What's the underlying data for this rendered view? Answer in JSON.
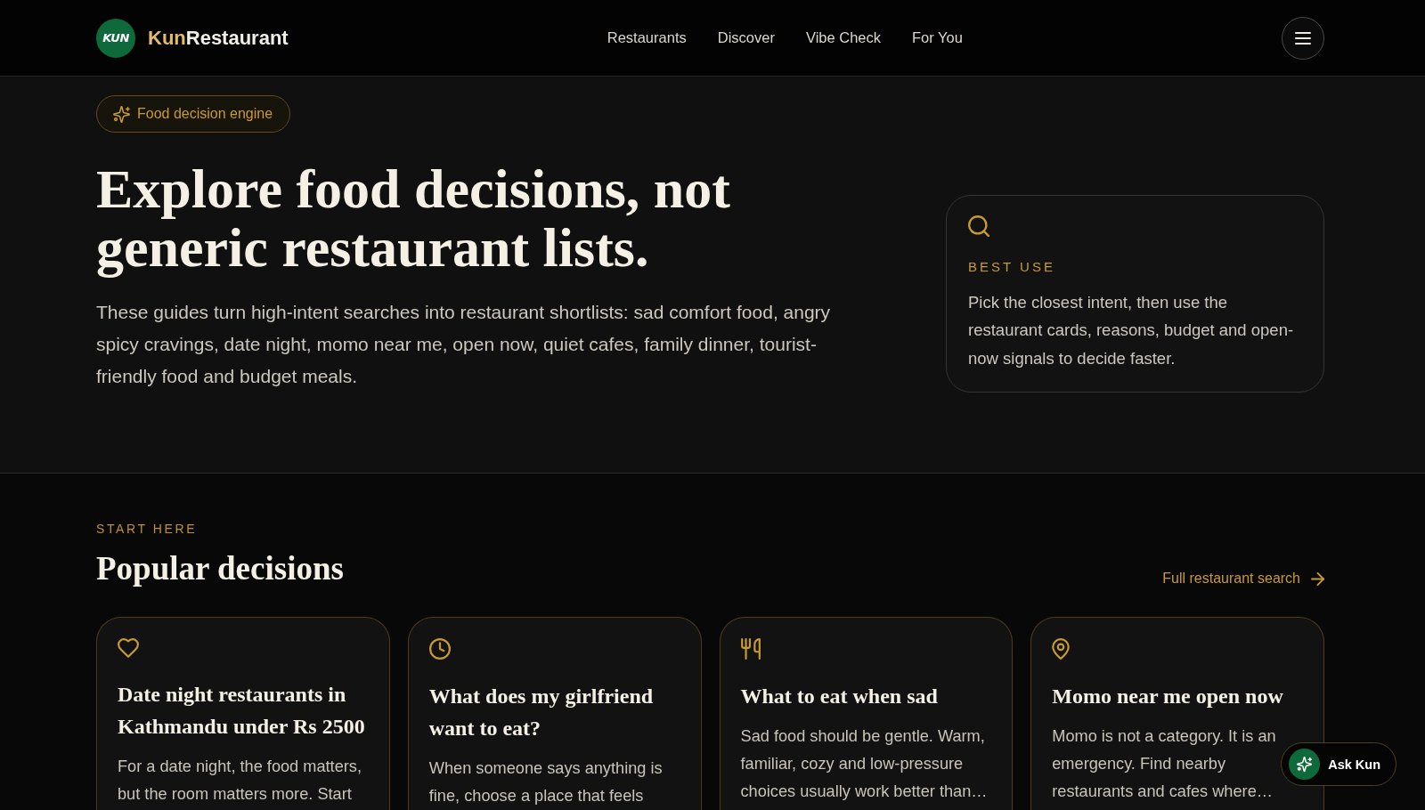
{
  "header": {
    "logo_text": "KUN",
    "brand_accent": "Kun",
    "brand_rest": "Restaurant",
    "nav": [
      {
        "label": "Restaurants"
      },
      {
        "label": "Discover"
      },
      {
        "label": "Vibe Check"
      },
      {
        "label": "For You"
      }
    ]
  },
  "hero": {
    "badge": "Food decision engine",
    "title": "Explore food decisions, not generic restaurant lists.",
    "description": "These guides turn high-intent searches into restaurant shortlists: sad comfort food, angry spicy cravings, date night, momo near me, open now, quiet cafes, family dinner, tourist-friendly food and budget meals.",
    "info_card": {
      "label": "BEST USE",
      "text": "Pick the closest intent, then use the restaurant cards, reasons, budget and open-now signals to decide faster."
    }
  },
  "popular": {
    "eyebrow": "START HERE",
    "title": "Popular decisions",
    "link": "Full restaurant search",
    "cards": [
      {
        "kind": "heart",
        "title": "Date night restaurants in Kathmandu under Rs 2500",
        "description": "For a date night, the food matters, but the room matters more. Start"
      },
      {
        "kind": "clock",
        "title": "What does my girlfriend want to eat?",
        "description": "When someone says anything is fine, choose a place that feels"
      },
      {
        "kind": "utensils",
        "title": "What to eat when sad",
        "description": "Sad food should be gentle. Warm, familiar, cozy and low-pressure choices usually work better than…"
      },
      {
        "kind": "pin",
        "title": "Momo near me open now",
        "description": "Momo is not a category. It is an emergency. Find nearby restaurants and cafes where…"
      }
    ]
  },
  "ask_button": {
    "label": "Ask Kun"
  }
}
